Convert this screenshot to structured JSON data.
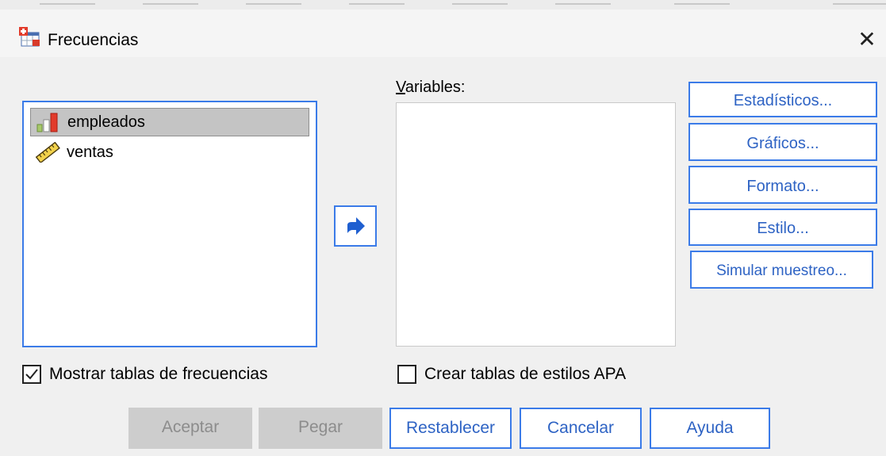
{
  "window": {
    "title": "Frecuencias",
    "close": "✕"
  },
  "source_list": {
    "items": [
      {
        "label": "empleados",
        "icon": "ordinal-bar-icon",
        "selected": true
      },
      {
        "label": "ventas",
        "icon": "scale-ruler-icon",
        "selected": false
      }
    ]
  },
  "target": {
    "label": "Variables:",
    "items": []
  },
  "side_buttons": {
    "estadisticos": "Estadísticos...",
    "graficos": "Gráficos...",
    "formato": "Formato...",
    "estilo": "Estilo...",
    "simular": "Simular muestreo..."
  },
  "checks": {
    "mostrar": {
      "label": "Mostrar tablas de frecuencias",
      "checked": true
    },
    "apa": {
      "label": "Crear tablas de estilos APA",
      "checked": false
    }
  },
  "buttons": {
    "aceptar": "Aceptar",
    "pegar": "Pegar",
    "restablecer": "Restablecer",
    "cancelar": "Cancelar",
    "ayuda": "Ayuda"
  },
  "colors": {
    "accent": "#3b7be8",
    "accent_text": "#2e63c4",
    "disabled": "#cdcdcd"
  }
}
